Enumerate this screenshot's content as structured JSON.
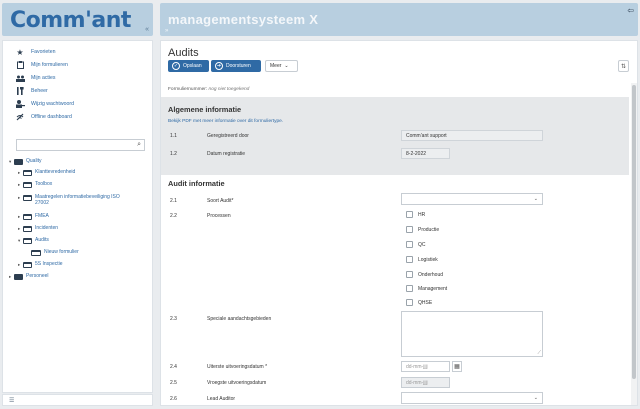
{
  "logo": {
    "text": "Comm'ant",
    "collapse_label": "«"
  },
  "header": {
    "title": "managementsysteem X",
    "expand_label": "»",
    "exit_icon": "exit-icon"
  },
  "sidebar": {
    "menu": [
      {
        "icon": "star-icon",
        "label": "Favorieten"
      },
      {
        "icon": "clipboard-icon",
        "label": "Mijn formulieren"
      },
      {
        "icon": "people-icon",
        "label": "Mijn acties"
      },
      {
        "icon": "tools-icon",
        "label": "Beheer"
      },
      {
        "icon": "user-key-icon",
        "label": "Wijzig wachtwoord"
      },
      {
        "icon": "offline-icon",
        "label": "Offline dashboard"
      }
    ],
    "search_placeholder": "",
    "tree": [
      {
        "label": "Quality",
        "caret": "▾",
        "folder": "dark",
        "level": 0
      },
      {
        "label": "Klanttevredenheid",
        "caret": "▸",
        "folder": "outline",
        "level": 1
      },
      {
        "label": "Toolbox",
        "caret": "▸",
        "folder": "outline",
        "level": 1
      },
      {
        "label": "Maatregelen informatiebeveiliging ISO 27002",
        "caret": "▸",
        "folder": "outline",
        "level": 1
      },
      {
        "label": "FMEA",
        "caret": "▸",
        "folder": "outline",
        "level": 1
      },
      {
        "label": "Incidenten",
        "caret": "▸",
        "folder": "outline",
        "level": 1
      },
      {
        "label": "Audits",
        "caret": "▾",
        "folder": "outline",
        "level": 1
      },
      {
        "label": "Nieuw formulier",
        "caret": "",
        "folder": "form",
        "level": 2
      },
      {
        "label": "5S Inspectie",
        "caret": "▸",
        "folder": "outline",
        "level": 1
      },
      {
        "label": "Personeel",
        "caret": "▸",
        "folder": "dark",
        "level": 0
      }
    ],
    "footer_icon": "menu-icon"
  },
  "form": {
    "title": "Audits",
    "buttons": {
      "save": "Opslaan",
      "forward": "Doorsturen",
      "more": "Meer",
      "sort_icon": "sort-icon"
    },
    "formnum_label": "Formuliernummer:",
    "formnum_value": "nog niet toegekend",
    "general": {
      "title": "Algemene informatie",
      "pdf_link": "Bekijk PDF met meer informatie over dit formuliertype.",
      "rows": [
        {
          "num": "1.1",
          "label": "Geregistreerd door",
          "value": "Comm'ant support"
        },
        {
          "num": "1.2",
          "label": "Datum registratie",
          "value": "8-2-2022"
        }
      ]
    },
    "audit": {
      "title": "Audit informatie",
      "rows": {
        "r21": {
          "num": "2.1",
          "label": "Soort Audit*",
          "value": ""
        },
        "r22": {
          "num": "2.2",
          "label": "Processen"
        },
        "r23": {
          "num": "2.3",
          "label": "Speciale aandachtsgebieden"
        },
        "r24": {
          "num": "2.4",
          "label": "Uiterste uitvoeringsdatum *",
          "placeholder": "dd-mm-jjjj"
        },
        "r25": {
          "num": "2.5",
          "label": "Vroegste uitvoeringsdatum",
          "placeholder": "dd-mm-jjjj"
        },
        "r26": {
          "num": "2.6",
          "label": "Lead Auditor",
          "value": ""
        }
      },
      "processes": [
        "HR",
        "Productie",
        "QC",
        "Logistiek",
        "Onderhoud",
        "Management",
        "QHSE"
      ]
    }
  },
  "colors": {
    "accent": "#2f6aa5",
    "header_bg": "#b8cfe0",
    "section_gray": "#e6e8ea"
  }
}
